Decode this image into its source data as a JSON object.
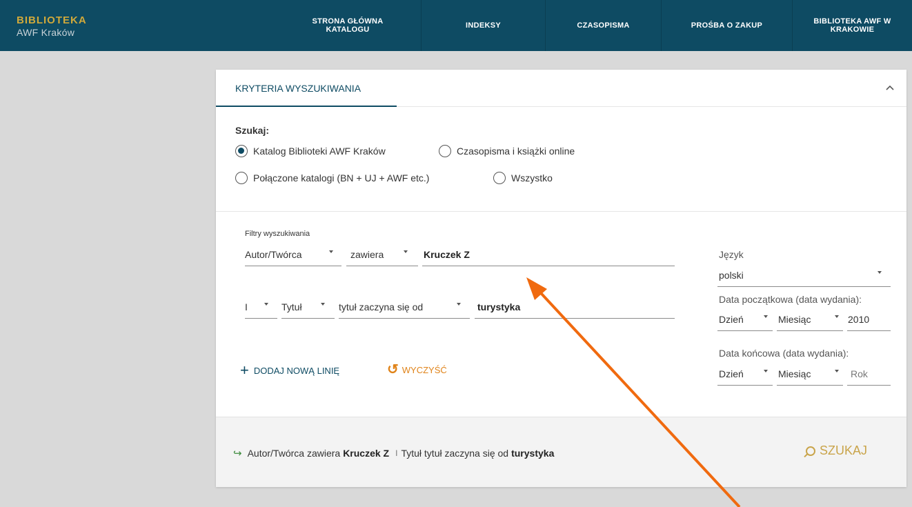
{
  "header": {
    "logo_line1": "BIBLIOTEKA",
    "logo_line2": "AWF Kraków",
    "nav": [
      "STRONA GŁÓWNA KATALOGU",
      "INDEKSY",
      "CZASOPISMA",
      "PROŚBA O ZAKUP",
      "BIBLIOTEKA AWF W KRAKOWIE"
    ]
  },
  "panel": {
    "tab_label": "KRYTERIA WYSZUKIWANIA",
    "collapse_icon": "chevron-up-icon",
    "szukaj_label": "Szukaj:",
    "scopes": [
      {
        "label": "Katalog Biblioteki AWF Kraków",
        "selected": true
      },
      {
        "label": "Czasopisma i książki online",
        "selected": false
      },
      {
        "label": "Połączone katalogi (BN + UJ + AWF etc.)",
        "selected": false
      },
      {
        "label": "Wszystko",
        "selected": false
      }
    ],
    "filters_label": "Filtry wyszukiwania",
    "line1": {
      "field": "Autor/Twórca",
      "operator": "zawiera",
      "value": "Kruczek Z"
    },
    "line2": {
      "boolean": "I",
      "field": "Tytuł",
      "operator": "tytuł zaczyna się od",
      "value": "turystyka"
    },
    "add_line": "DODAJ NOWĄ LINIĘ",
    "clear": "WYCZYŚĆ",
    "language": {
      "label": "Język",
      "value": "polski"
    },
    "start_date": {
      "label": "Data początkowa (data wydania):",
      "day": "Dzień",
      "month": "Miesiąc",
      "year": "2010"
    },
    "end_date": {
      "label": "Data końcowa (data wydania):",
      "day": "Dzień",
      "month": "Miesiąc",
      "year": "Rok"
    },
    "query_summary": {
      "p1": "Autor/Twórca zawiera",
      "v1": "Kruczek Z",
      "sep": "I",
      "p2": "Tytuł tytuł zaczyna się od",
      "v2": "turystyka"
    },
    "search_button": "SZUKAJ"
  },
  "colors": {
    "header_bg": "#0e4b63",
    "logo_gold": "#d1a93a",
    "accent_orange": "#e08319",
    "search_gold": "#c9a44a",
    "annotation_arrow": "#f06a0f"
  }
}
